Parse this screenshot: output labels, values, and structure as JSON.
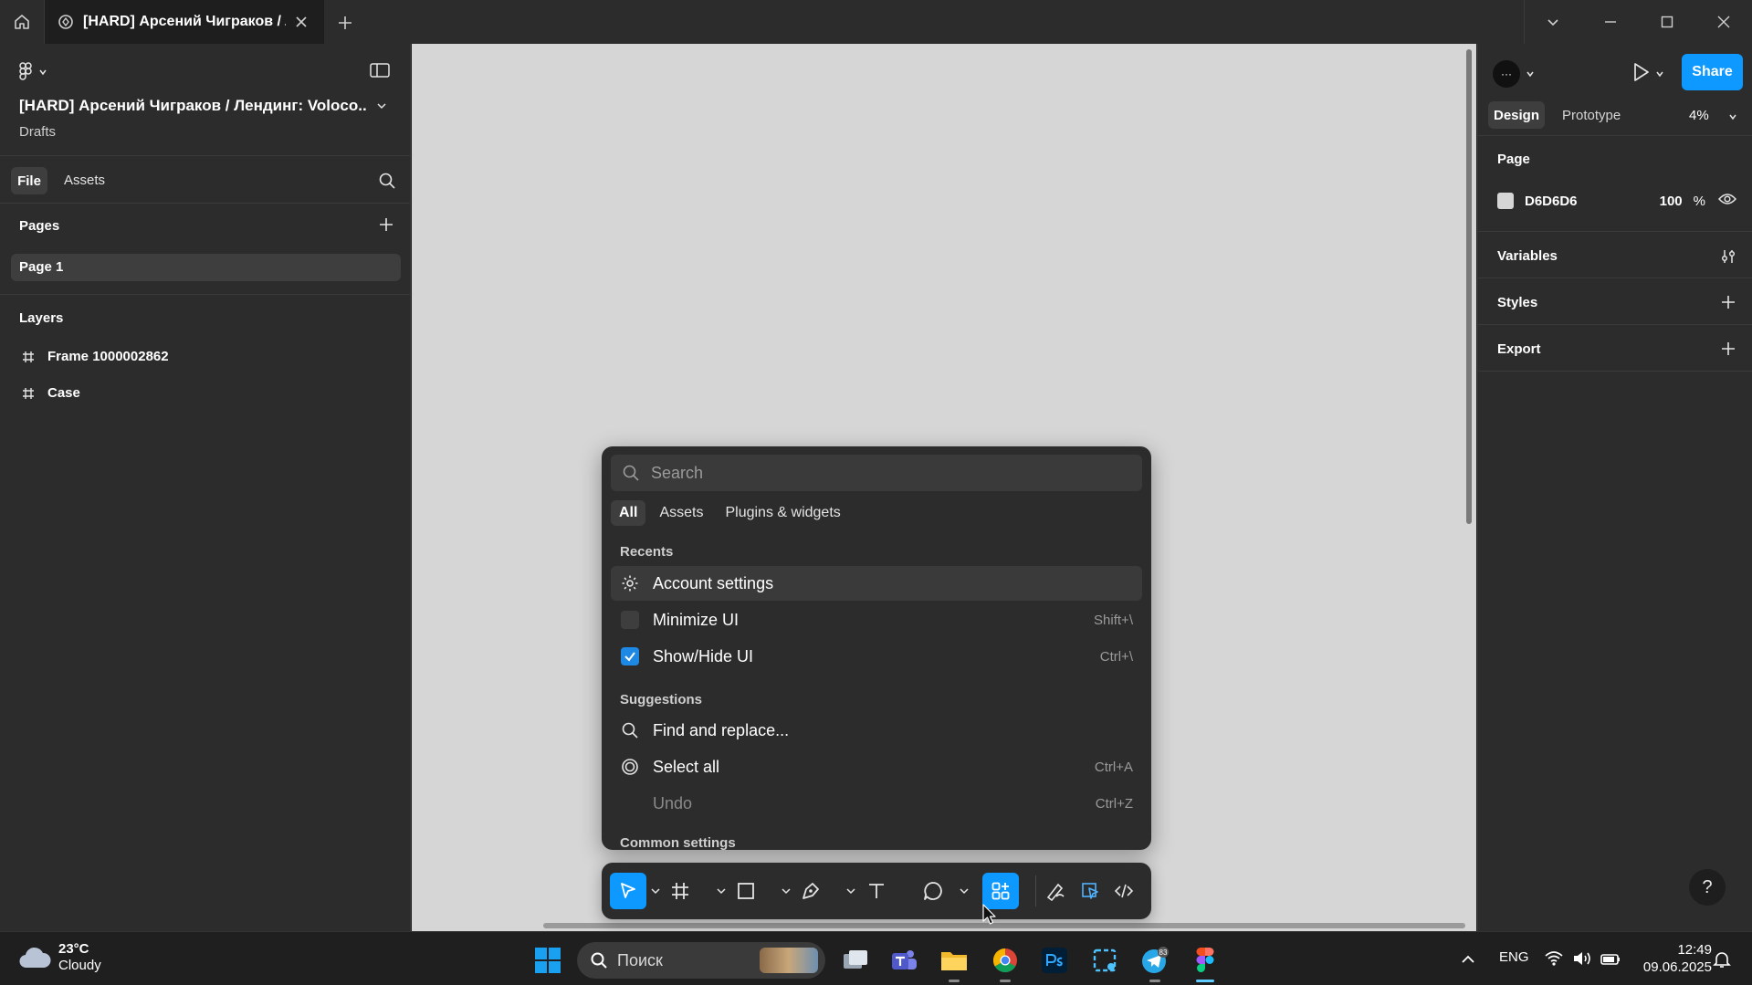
{
  "titlebar": {
    "tab_title": "[HARD] Арсений Чиграков / Лендинг: Volocopter",
    "icons": [
      "home-icon",
      "figma-tab-icon",
      "close-icon",
      "plus-icon",
      "chevron-down-icon",
      "minimize-icon",
      "maximize-icon",
      "close-window-icon"
    ]
  },
  "left_panel": {
    "file_name": "[HARD] Арсений Чиграков / Лендинг: Voloco...",
    "location": "Drafts",
    "tabs": {
      "file": "File",
      "assets": "Assets"
    },
    "pages_heading": "Pages",
    "pages": [
      "Page 1"
    ],
    "layers_heading": "Layers",
    "layers": [
      "Frame 1000002862",
      "Case"
    ]
  },
  "quick_actions": {
    "search_placeholder": "Search",
    "tabs": [
      "All",
      "Assets",
      "Plugins & widgets"
    ],
    "active_tab": "All",
    "recents_heading": "Recents",
    "recents": [
      {
        "label": "Account settings",
        "shortcut": "",
        "icon": "gear-icon"
      },
      {
        "label": "Minimize UI",
        "shortcut": "Shift+\\",
        "icon": "checkbox-unchecked"
      },
      {
        "label": "Show/Hide UI",
        "shortcut": "Ctrl+\\",
        "icon": "checkbox-checked"
      }
    ],
    "suggestions_heading": "Suggestions",
    "suggestions": [
      {
        "label": "Find and replace...",
        "shortcut": "",
        "icon": "search-icon"
      },
      {
        "label": "Select all",
        "shortcut": "Ctrl+A",
        "icon": "select-all-icon"
      },
      {
        "label": "Undo",
        "shortcut": "Ctrl+Z",
        "icon": ""
      }
    ],
    "common_heading": "Common settings"
  },
  "toolbar": {
    "tools": [
      "move-tool-icon",
      "frame-tool-icon",
      "rectangle-tool-icon",
      "pen-tool-icon",
      "text-tool-icon",
      "comment-tool-icon",
      "actions-icon",
      "draw-mode-icon",
      "design-mode-icon",
      "dev-mode-icon"
    ],
    "active_tool": "actions-icon"
  },
  "right_panel": {
    "avatar_text": "···",
    "share_label": "Share",
    "tabs": {
      "design": "Design",
      "prototype": "Prototype"
    },
    "zoom": "4%",
    "page_heading": "Page",
    "page_color_hex": "D6D6D6",
    "page_color": "#D6D6D6",
    "page_opacity": "100",
    "opacity_unit": "%",
    "variables_heading": "Variables",
    "styles_heading": "Styles",
    "export_heading": "Export",
    "help_label": "?"
  },
  "taskbar": {
    "temperature": "23°C",
    "condition": "Cloudy",
    "search_placeholder": "Поиск",
    "language": "ENG",
    "time": "12:49",
    "date": "09.06.2025",
    "telegram_badge": "83"
  },
  "colors": {
    "accent": "#0d99ff",
    "canvas": "#d6d6d6",
    "panel": "#2c2c2c"
  }
}
